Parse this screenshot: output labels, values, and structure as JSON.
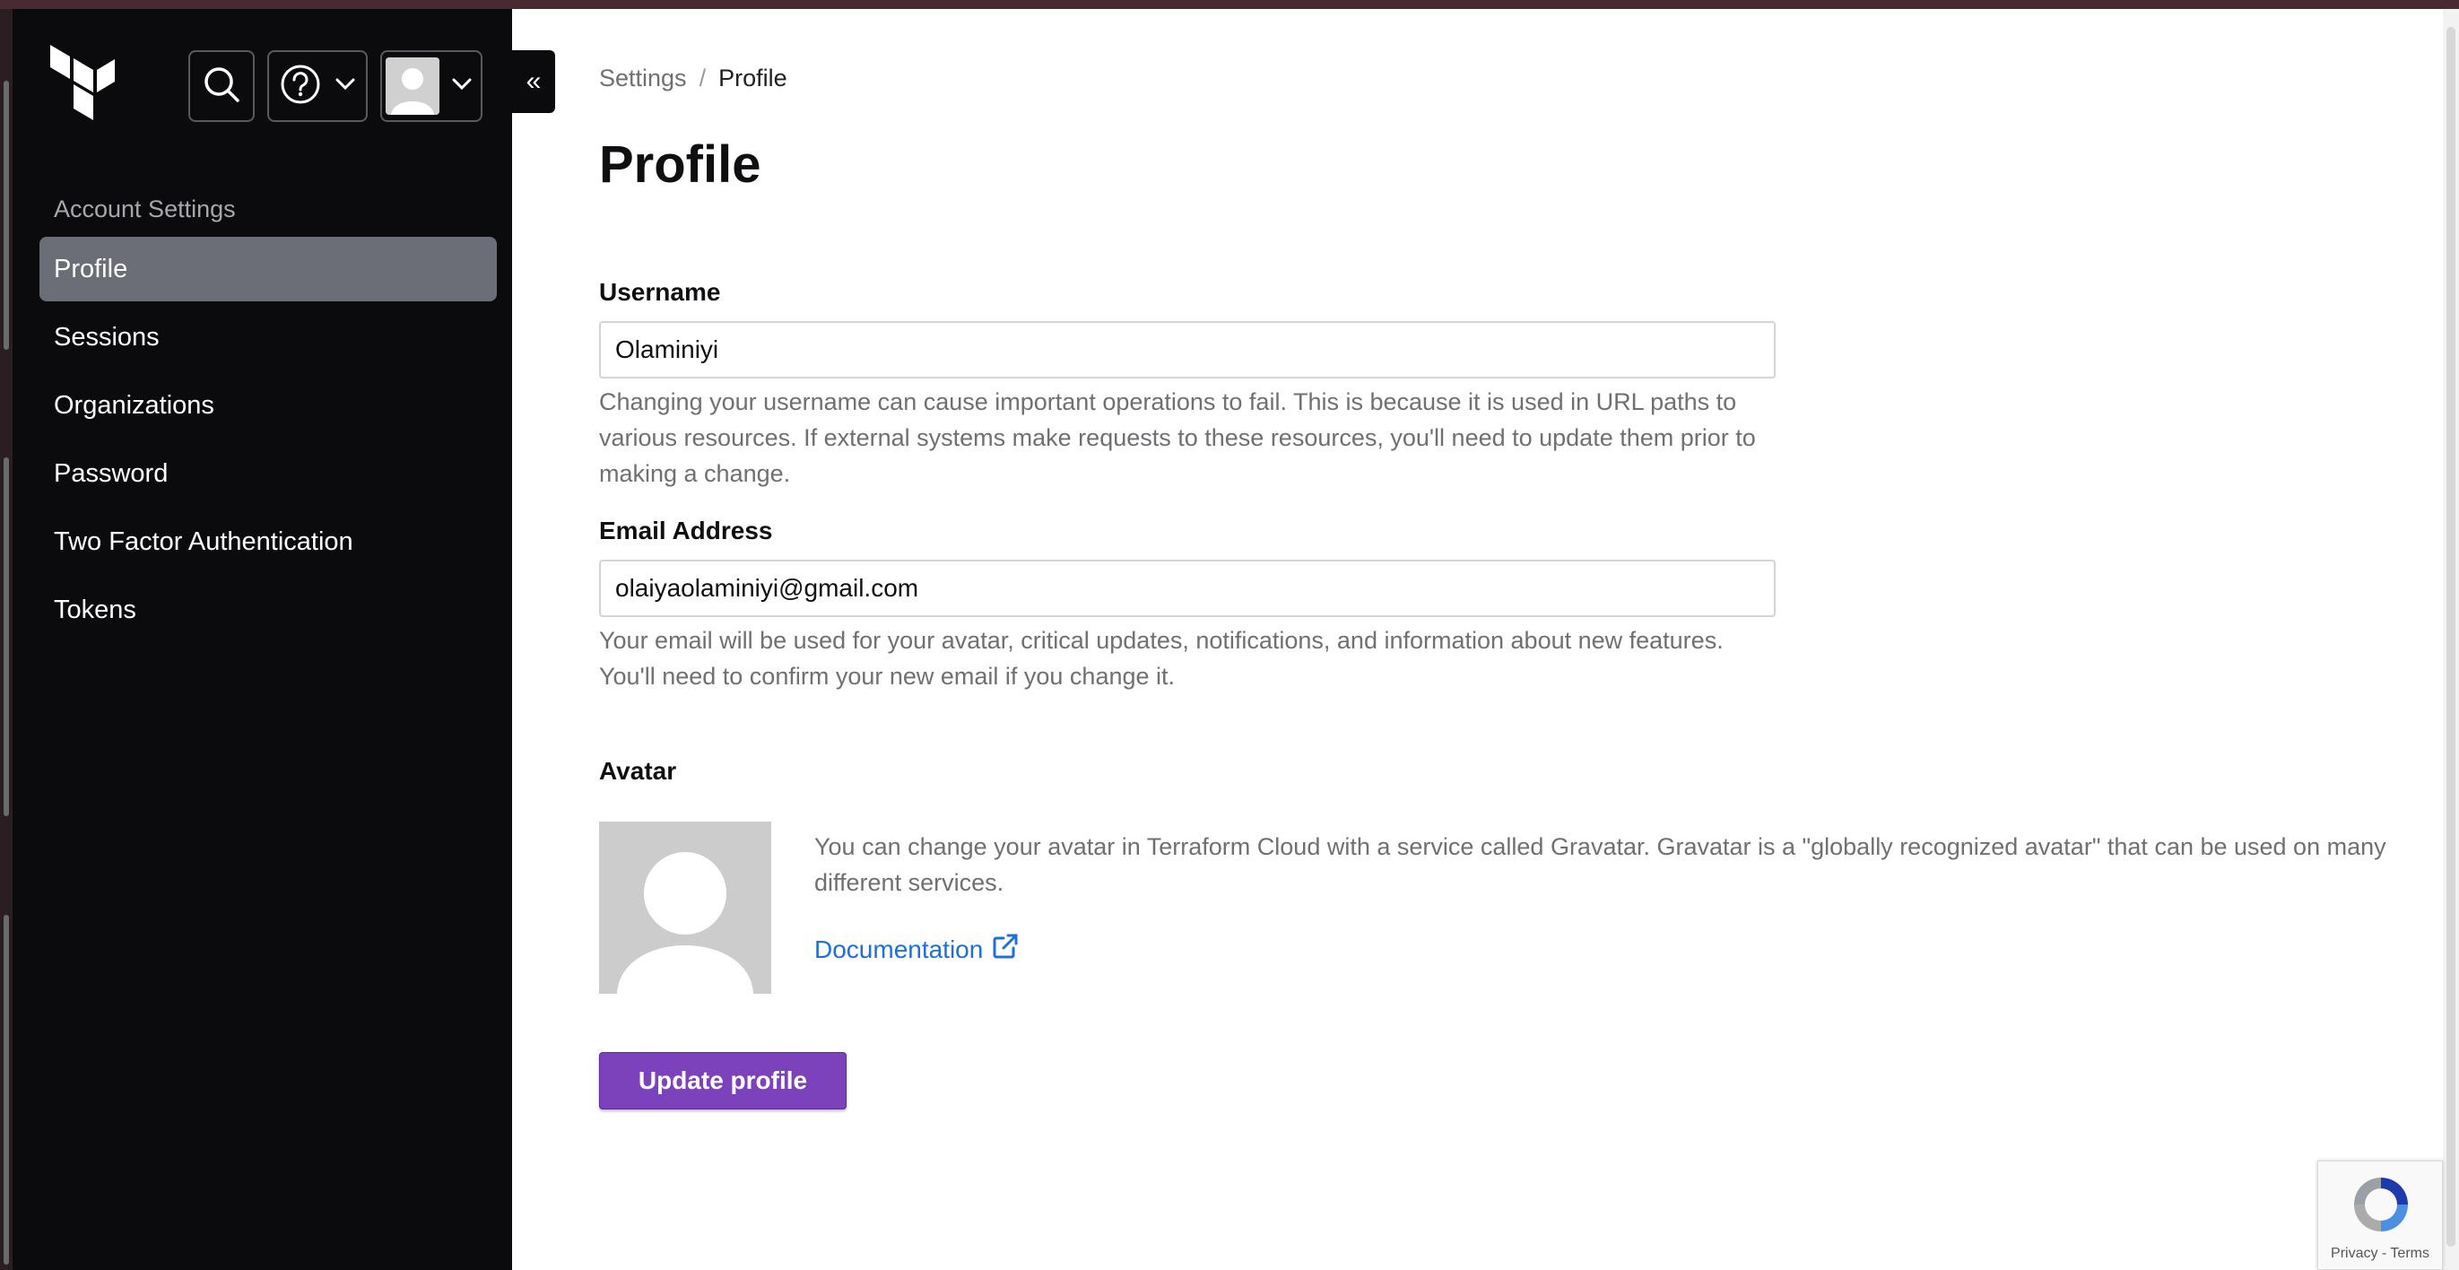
{
  "sidebar": {
    "heading": "Account Settings",
    "items": [
      {
        "label": "Profile",
        "active": true
      },
      {
        "label": "Sessions",
        "active": false
      },
      {
        "label": "Organizations",
        "active": false
      },
      {
        "label": "Password",
        "active": false
      },
      {
        "label": "Two Factor Authentication",
        "active": false
      },
      {
        "label": "Tokens",
        "active": false
      }
    ]
  },
  "header": {
    "icons": [
      "terraform-logo",
      "search-icon",
      "help-icon",
      "chevron-down-icon",
      "user-avatar",
      "chevron-down-icon"
    ],
    "collapse_label": "«"
  },
  "breadcrumb": {
    "parent": "Settings",
    "separator": "/",
    "current": "Profile"
  },
  "page": {
    "title": "Profile"
  },
  "form": {
    "username": {
      "label": "Username",
      "value": "Olaminiyi",
      "help": "Changing your username can cause important operations to fail. This is because it is used in URL paths to various resources. If external systems make requests to these resources, you'll need to update them prior to making a change."
    },
    "email": {
      "label": "Email Address",
      "value": "olaiyaolaminiyi@gmail.com",
      "help": "Your email will be used for your avatar, critical updates, notifications, and information about new features. You'll need to confirm your new email if you change it."
    },
    "avatar": {
      "label": "Avatar",
      "description": "You can change your avatar in Terraform Cloud with a service called Gravatar. Gravatar is a \"globally recognized avatar\" that can be used on many different services.",
      "link_label": "Documentation"
    },
    "submit_label": "Update profile"
  },
  "recaptcha": {
    "links": "Privacy - Terms"
  },
  "colors": {
    "sidebar_bg": "#0b0b0d",
    "active_item": "#6b6e76",
    "primary_button": "#7b42bc",
    "link": "#1f6fd8"
  }
}
